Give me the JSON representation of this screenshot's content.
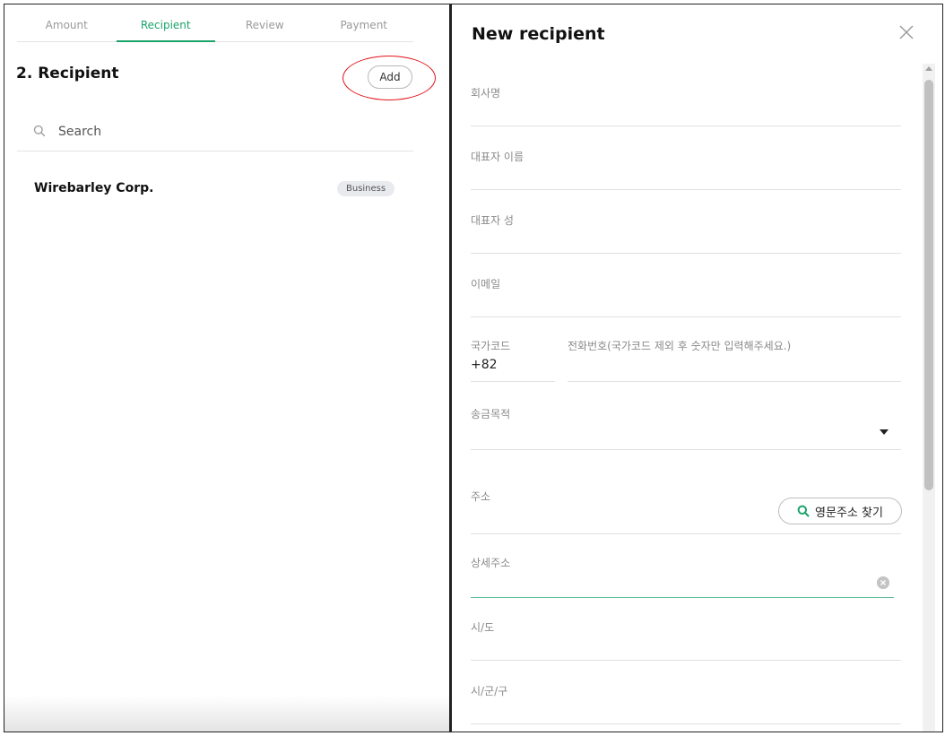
{
  "tabs": [
    {
      "label": "Amount"
    },
    {
      "label": "Recipient"
    },
    {
      "label": "Review"
    },
    {
      "label": "Payment"
    }
  ],
  "section": {
    "title": "2. Recipient",
    "add_label": "Add"
  },
  "search": {
    "placeholder": "Search"
  },
  "recipients": [
    {
      "name": "Wirebarley Corp.",
      "badge": "Business"
    }
  ],
  "panel": {
    "title": "New recipient",
    "fields": {
      "company_name": "회사명",
      "rep_first_name": "대표자 이름",
      "rep_last_name": "대표자 성",
      "email": "이메일",
      "country_code_label": "국가코드",
      "country_code_value": "+82",
      "phone_label": "전화번호(국가코드 제외 후 숫자만 입력해주세요.)",
      "purpose": "송금목적",
      "address": "주소",
      "address_button": "영문주소 찾기",
      "address_detail": "상세주소",
      "city": "시/도",
      "district": "시/군/구"
    }
  },
  "colors": {
    "accent": "#1aa36b",
    "annotation": "#e0141b"
  }
}
